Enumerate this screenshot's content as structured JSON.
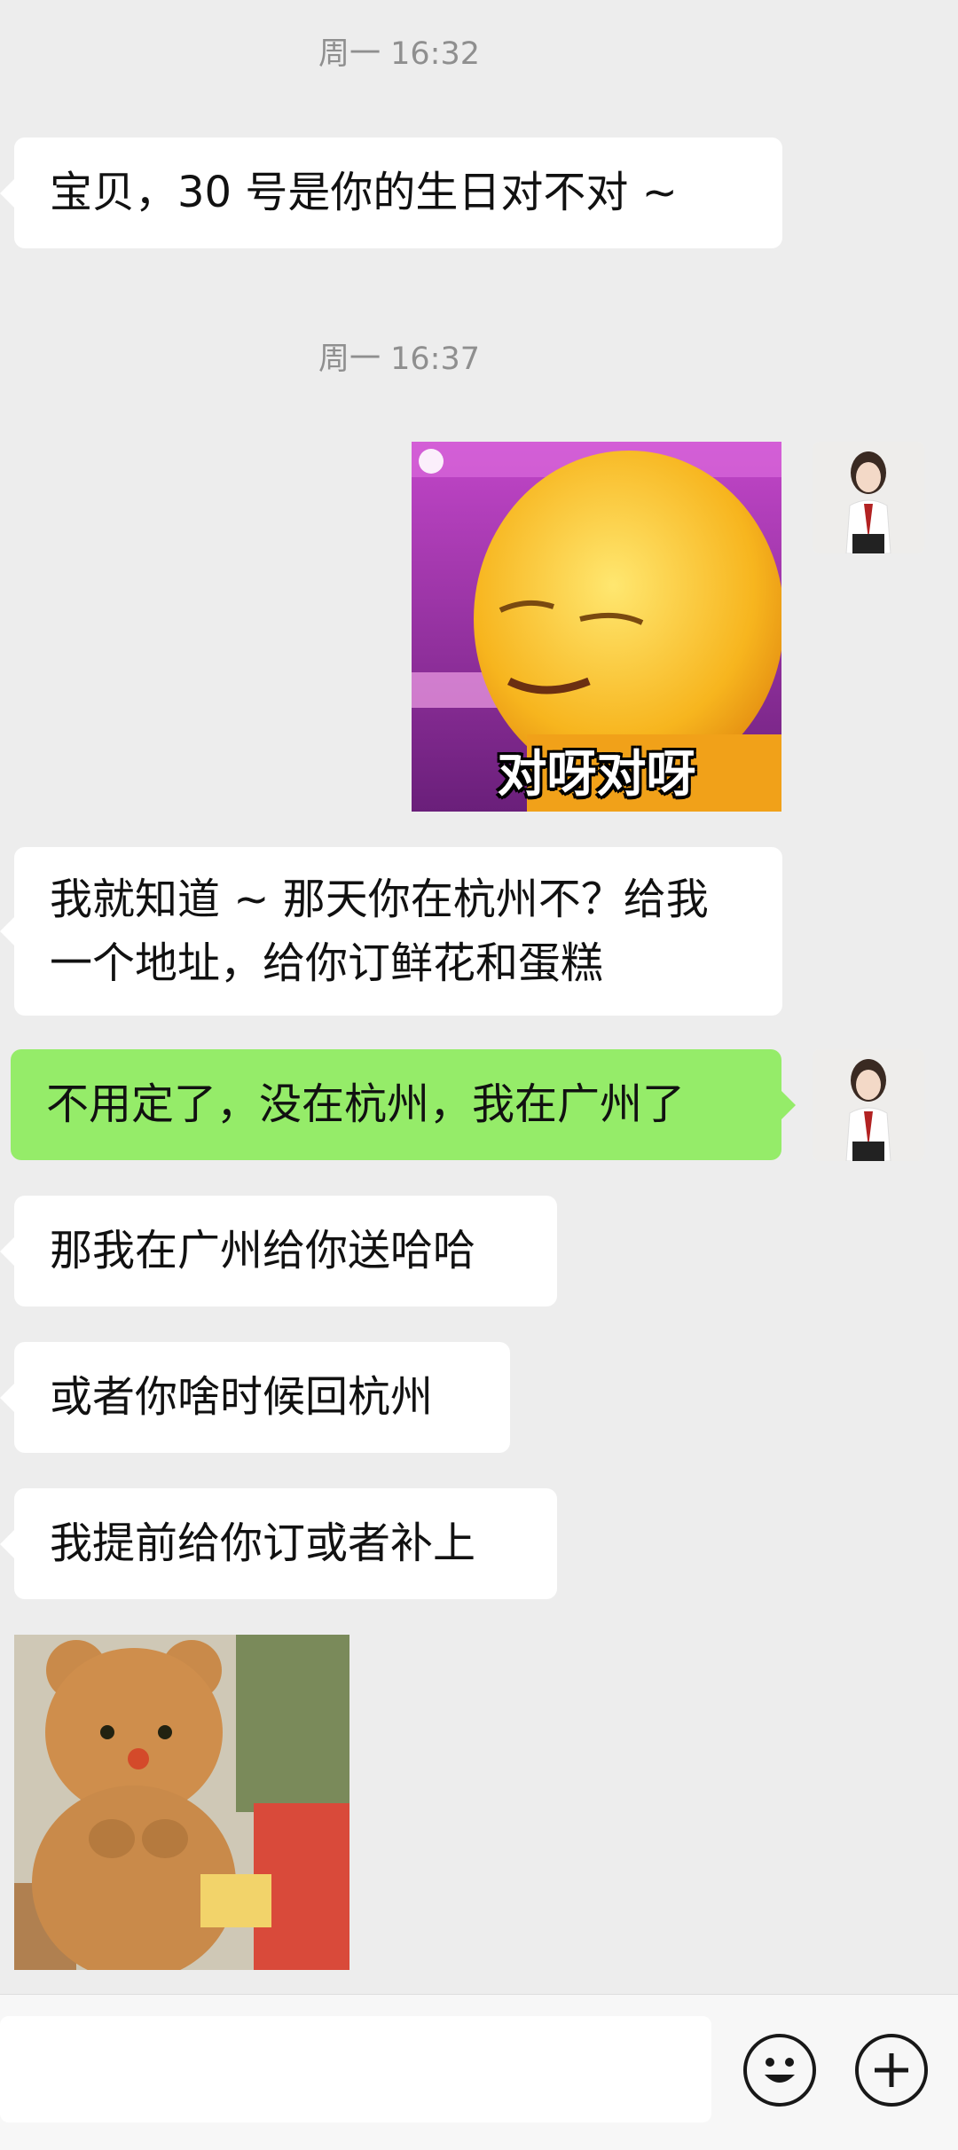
{
  "colors": {
    "background": "#ededed",
    "incoming_bubble": "#ffffff",
    "outgoing_bubble": "#95ec69",
    "timestamp": "#8f8f8f"
  },
  "messages": [
    {
      "type": "timestamp",
      "text": "周一 16:32"
    },
    {
      "type": "text",
      "side": "incoming",
      "text": "宝贝，30 号是你的生日对不对 ~"
    },
    {
      "type": "timestamp",
      "text": "周一 16:37"
    },
    {
      "type": "sticker",
      "side": "outgoing",
      "caption": "对呀对呀",
      "description": "yellow-character-sticker"
    },
    {
      "type": "text",
      "side": "incoming",
      "lines": [
        "我就知道 ~ 那天你在杭州不？给我",
        "一个地址，给你订鲜花和蛋糕"
      ]
    },
    {
      "type": "text",
      "side": "outgoing",
      "text": "不用定了，没在杭州，我在广州了"
    },
    {
      "type": "text",
      "side": "incoming",
      "text": "那我在广州给你送哈哈"
    },
    {
      "type": "text",
      "side": "incoming",
      "text": "或者你啥时候回杭州"
    },
    {
      "type": "text",
      "side": "incoming",
      "text": "我提前给你订或者补上"
    },
    {
      "type": "sticker",
      "side": "incoming",
      "caption": "",
      "description": "teddy-bear-sticker"
    }
  ],
  "input_bar": {
    "emoji_icon": "smiley-icon",
    "plus_icon": "plus-circle-icon"
  }
}
